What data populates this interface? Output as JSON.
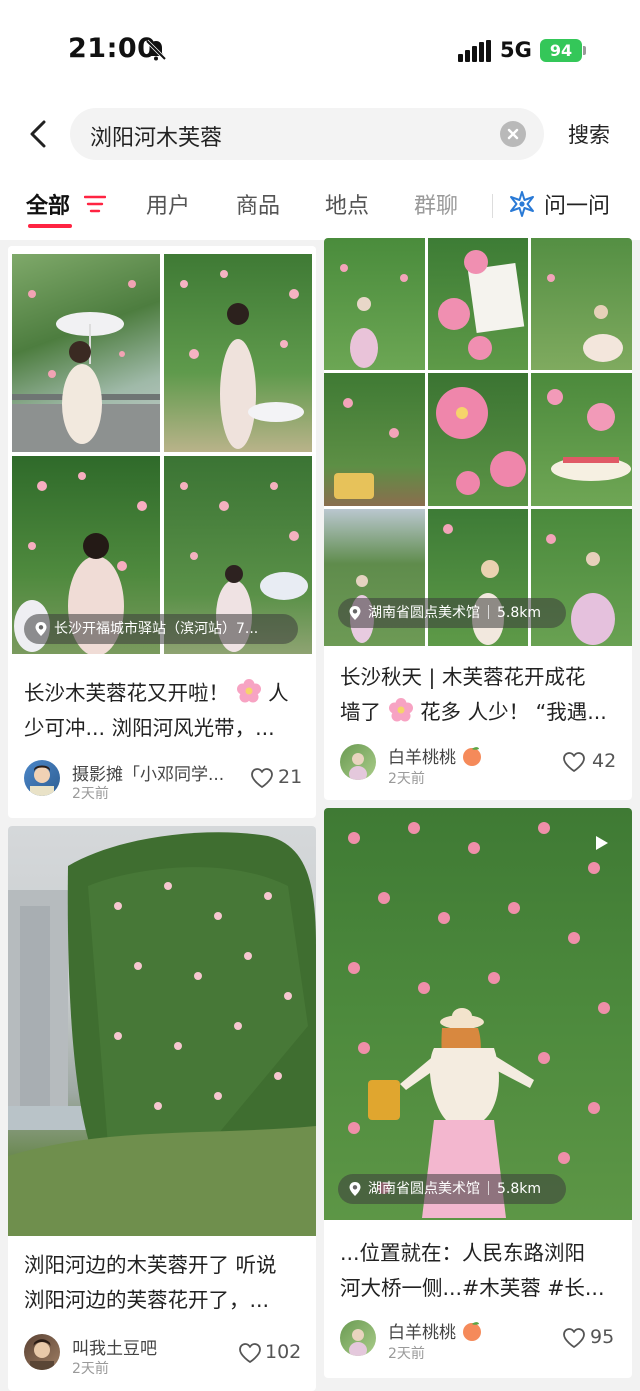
{
  "status_bar": {
    "time": "21:00",
    "network": "5G",
    "battery": "94"
  },
  "search": {
    "query": "浏阳河木芙蓉",
    "submit_label": "搜索"
  },
  "tabs": [
    {
      "label": "全部",
      "active": true
    },
    {
      "label": "用户"
    },
    {
      "label": "商品"
    },
    {
      "label": "地点"
    },
    {
      "label": "群聊"
    }
  ],
  "ask": {
    "label": "问一问"
  },
  "posts": [
    {
      "location": "长沙开福城市驿站（滨河站）7...",
      "location_distance": "",
      "title_line1_a": "长沙木芙蓉花又开啦！",
      "title_line1_b": "人",
      "title_line2": "少可冲... 浏阳河风光带，...",
      "author": "摄影摊「小邓同学...",
      "time": "2天前",
      "likes": "21"
    },
    {
      "location": "湖南省圆点美术馆",
      "location_distance": "5.8km",
      "title_line1": "长沙秋天 | 木芙蓉花开成花",
      "title_line2_a": "墙了",
      "title_line2_b": "花多 人少！ “我遇...",
      "author": "白羊桃桃",
      "time": "2天前",
      "likes": "42"
    },
    {
      "title_line1": "浏阳河边的木芙蓉开了 听说",
      "title_line2": "浏阳河边的芙蓉花开了，...",
      "author": "叫我土豆吧",
      "time": "2天前",
      "likes": "102"
    },
    {
      "location": "湖南省圆点美术馆",
      "location_distance": "5.8km",
      "title_line1": "...位置就在：人民东路浏阳",
      "title_line2": "河大桥一侧...#木芙蓉 #长...",
      "author": "白羊桃桃",
      "time": "2天前",
      "likes": "95"
    }
  ],
  "colors": {
    "accent": "#ff2442",
    "battery": "#34c759",
    "ask_icon": "#2a7ad6"
  },
  "icons": [
    "bell-muted-icon",
    "signal-icon",
    "back-arrow-icon",
    "clear-icon",
    "filter-icon",
    "ask-star-icon",
    "location-pin-icon",
    "heart-icon",
    "flower-emoji-icon",
    "peach-emoji-icon",
    "play-icon"
  ]
}
